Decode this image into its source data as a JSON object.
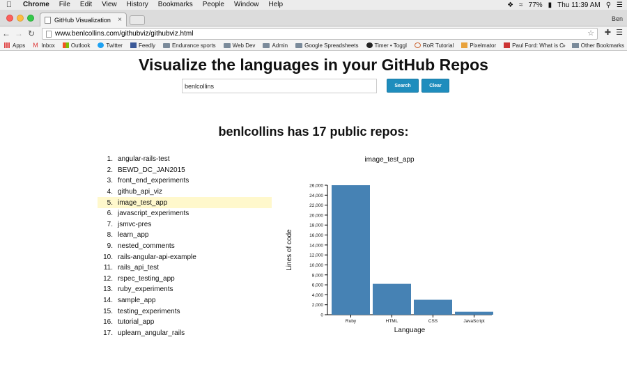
{
  "menubar": {
    "app_name": "Chrome",
    "items": [
      "File",
      "Edit",
      "View",
      "History",
      "Bookmarks",
      "People",
      "Window",
      "Help"
    ],
    "battery": "77%",
    "clock": "Thu 11:39 AM"
  },
  "browser": {
    "tab_title": "GitHub Visualization",
    "profile_name": "Ben",
    "url": "www.benlcollins.com/githubviz/githubviz.html",
    "bookmarks": [
      "Apps",
      "Inbox",
      "Outlook",
      "Twitter",
      "Feedly",
      "Endurance sports",
      "Web Dev",
      "Admin",
      "Google Spreadsheets",
      "Timer • Toggl",
      "RoR Tutorial",
      "Pixelmator",
      "Paul Ford: What is C"
    ],
    "other_bookmarks": "Other Bookmarks",
    "overflow": "»"
  },
  "page": {
    "heading": "Visualize the languages in your GitHub Repos",
    "search_value": "benlcollins",
    "search_button": "Search",
    "clear_button": "Clear",
    "subheading": "benlcollins has 17 public repos:",
    "repos": [
      "angular-rails-test",
      "BEWD_DC_JAN2015",
      "front_end_experiments",
      "github_api_viz",
      "image_test_app",
      "javascript_experiments",
      "jsmvc-pres",
      "learn_app",
      "nested_comments",
      "rails-angular-api-example",
      "rails_api_test",
      "rspec_testing_app",
      "ruby_experiments",
      "sample_app",
      "testing_experiments",
      "tutorial_app",
      "uplearn_angular_rails"
    ],
    "selected_index": 4,
    "accent_color": "#1f8dbd",
    "highlight_color": "#fff8cc"
  },
  "chart_data": {
    "type": "bar",
    "title": "image_test_app",
    "xlabel": "Language",
    "ylabel": "Lines of code",
    "categories": [
      "Ruby",
      "HTML",
      "CSS",
      "JavaScript"
    ],
    "values": [
      26000,
      6200,
      3000,
      600
    ],
    "ylim": [
      0,
      26000
    ],
    "yticks": [
      0,
      2000,
      4000,
      6000,
      8000,
      10000,
      12000,
      14000,
      16000,
      18000,
      20000,
      22000,
      24000,
      26000
    ],
    "bar_color": "#4682b4",
    "grid": false,
    "legend": "none"
  }
}
